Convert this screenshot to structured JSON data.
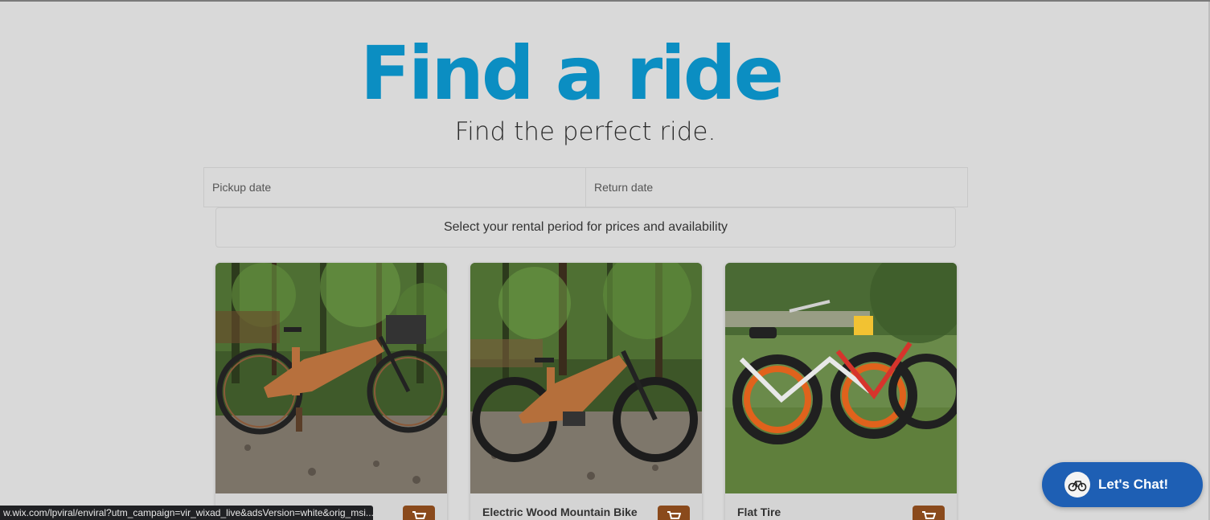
{
  "hero": {
    "title": "Find a ride",
    "subtitle": "Find the perfect ride."
  },
  "dates": {
    "pickup_placeholder": "Pickup date",
    "return_placeholder": "Return date"
  },
  "rental_note": "Select your rental period for prices and availability",
  "products": [
    {
      "name": "",
      "icon": "cart-icon"
    },
    {
      "name": "Electric Wood Mountain Bike",
      "icon": "cart-icon"
    },
    {
      "name": "Flat Tire",
      "icon": "cart-icon"
    }
  ],
  "status_url": "w.wix.com/lpviral/enviral?utm_campaign=vir_wixad_live&adsVersion=white&orig_msi...",
  "chat": {
    "label": "Let's Chat!",
    "icon": "bike-logo-icon"
  },
  "colors": {
    "background": "#d9d9d9",
    "title_blue": "#0b8ec2",
    "cart_brown": "#8a4a1c",
    "chat_blue": "#1e5fb4"
  }
}
